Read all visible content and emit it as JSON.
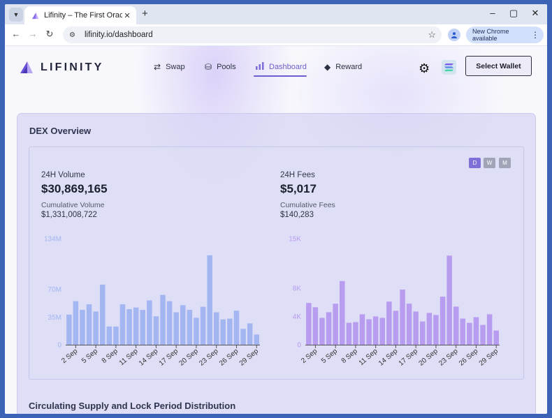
{
  "browser": {
    "tab_title": "Lifinity – The First Oracle-Based",
    "url": "lifinity.io/dashboard",
    "chrome_pill": "New Chrome available",
    "tab_close": "✕",
    "new_tab": "+",
    "minimize": "–",
    "maximize": "▢",
    "close": "✕"
  },
  "nav": {
    "logo": "LIFINITY",
    "items": [
      {
        "label": "Swap",
        "icon": "swap-icon"
      },
      {
        "label": "Pools",
        "icon": "pools-icon"
      },
      {
        "label": "Dashboard",
        "icon": "dashboard-icon"
      },
      {
        "label": "Reward",
        "icon": "diamond-icon"
      }
    ],
    "active": "Dashboard",
    "wallet_button": "Select Wallet"
  },
  "overview": {
    "title": "DEX Overview",
    "periods": [
      "D",
      "W",
      "M"
    ],
    "selected_period": "D",
    "volume_label": "24H Volume",
    "volume_value": "$30,869,165",
    "cum_volume_label": "Cumulative Volume",
    "cum_volume_value": "$1,331,008,722",
    "fees_label": "24H Fees",
    "fees_value": "$5,017",
    "cum_fees_label": "Cumulative Fees",
    "cum_fees_value": "$140,283"
  },
  "chart_data": [
    {
      "type": "bar",
      "name": "volume",
      "color": "#a3b6f2",
      "yticks": [
        {
          "label": "0",
          "value": 0
        },
        {
          "label": "35M",
          "value": 35
        },
        {
          "label": "70M",
          "value": 70
        },
        {
          "label": "134M",
          "value": 134
        }
      ],
      "ylim": [
        0,
        134
      ],
      "xticks": [
        "2 Sep",
        "5 Sep",
        "8 Sep",
        "11 Sep",
        "14 Sep",
        "17 Sep",
        "20 Sep",
        "23 Sep",
        "26 Sep",
        "29 Sep"
      ],
      "xtick_index": [
        1,
        4,
        7,
        10,
        13,
        16,
        19,
        22,
        25,
        28
      ],
      "values": [
        38,
        55,
        44,
        51,
        42,
        76,
        23,
        23,
        51,
        45,
        47,
        44,
        56,
        36,
        63,
        55,
        41,
        50,
        44,
        34,
        48,
        113,
        41,
        32,
        33,
        43,
        20,
        27,
        13
      ]
    },
    {
      "type": "bar",
      "name": "fees",
      "color": "#b89cf0",
      "yticks": [
        {
          "label": "0",
          "value": 0
        },
        {
          "label": "4K",
          "value": 4
        },
        {
          "label": "8K",
          "value": 8
        },
        {
          "label": "15K",
          "value": 15
        }
      ],
      "ylim": [
        0,
        15
      ],
      "xticks": [
        "2 Sep",
        "5 Sep",
        "8 Sep",
        "11 Sep",
        "14 Sep",
        "17 Sep",
        "20 Sep",
        "23 Sep",
        "26 Sep",
        "29 Sep"
      ],
      "xtick_index": [
        1,
        4,
        7,
        10,
        13,
        16,
        19,
        22,
        25,
        28
      ],
      "values": [
        5.9,
        5.3,
        3.8,
        4.6,
        5.8,
        9.0,
        3.1,
        3.2,
        4.3,
        3.6,
        4.0,
        3.8,
        6.1,
        4.8,
        7.8,
        5.8,
        4.7,
        3.3,
        4.5,
        4.2,
        6.8,
        12.6,
        5.4,
        3.7,
        3.1,
        3.9,
        2.8,
        4.3,
        2.0
      ]
    }
  ],
  "section2_title": "Circulating Supply and Lock Period Distribution"
}
